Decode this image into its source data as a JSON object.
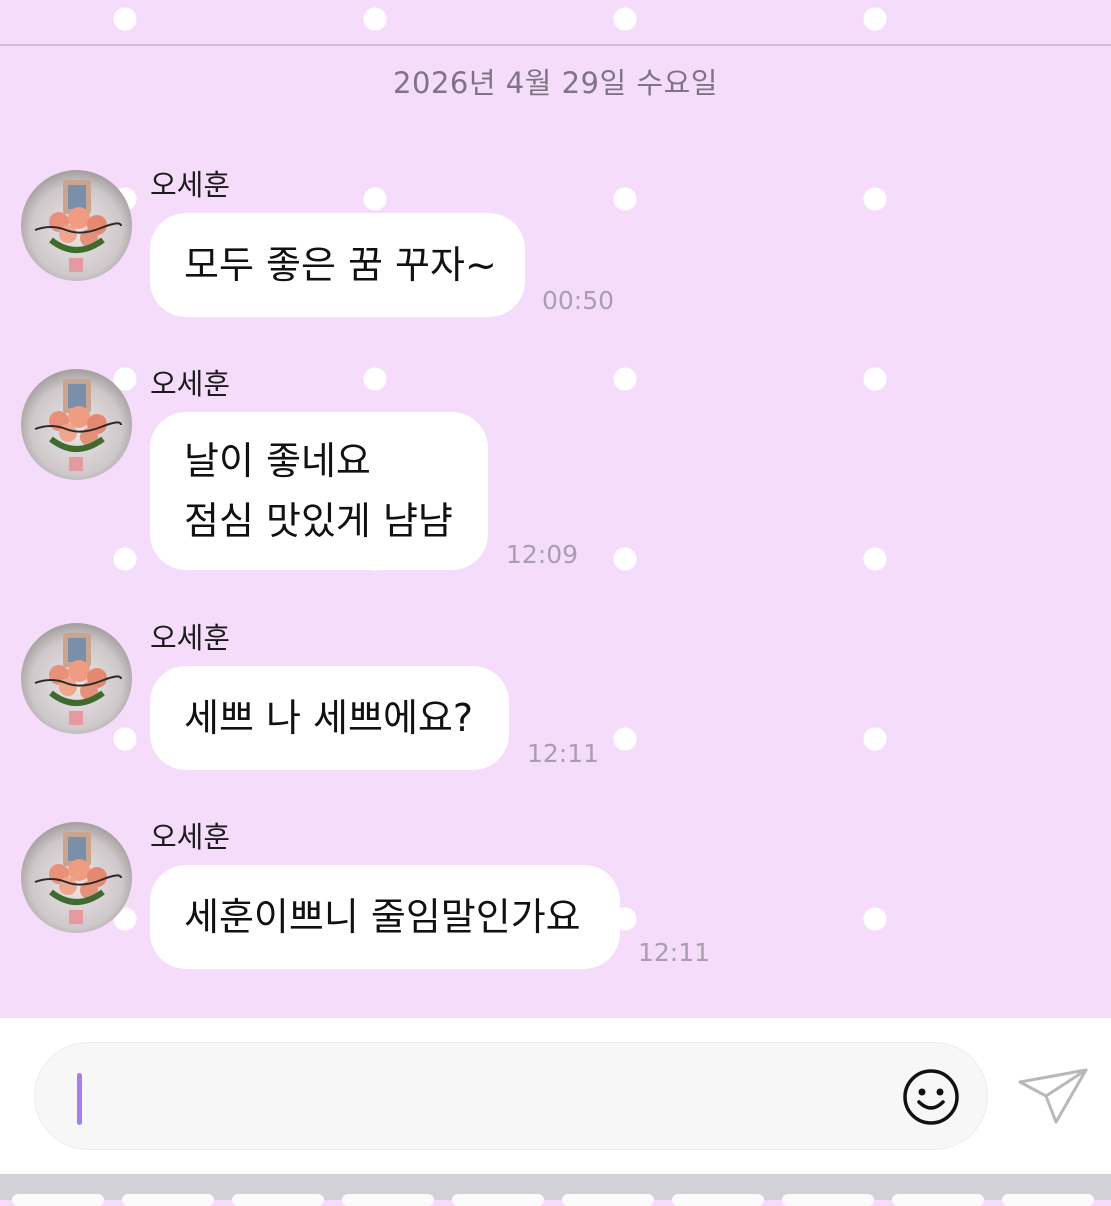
{
  "date_separator": "2026년 4월 29일 수요일",
  "messages": [
    {
      "sender": "오세훈",
      "lines": [
        "모두 좋은 꿈 꾸자~"
      ],
      "time": "00:50"
    },
    {
      "sender": "오세훈",
      "lines": [
        "날이 좋네요",
        "점심 맛있게 냠냠"
      ],
      "time": "12:09"
    },
    {
      "sender": "오세훈",
      "lines": [
        "세쁘 나 세쁘에요?"
      ],
      "time": "12:11"
    },
    {
      "sender": "오세훈",
      "lines": [
        "세훈이쁘니 줄임말인가요"
      ],
      "time": "12:11"
    }
  ],
  "composer": {
    "input_value": "",
    "emoji_icon": "smiley-face-icon",
    "send_icon": "paper-plane-icon",
    "caret_color": "#a77ef0"
  },
  "colors": {
    "background": "#f5dcfb",
    "dots": "#ffffff",
    "bubble": "#ffffff",
    "timestamp": "#a99eb0"
  }
}
